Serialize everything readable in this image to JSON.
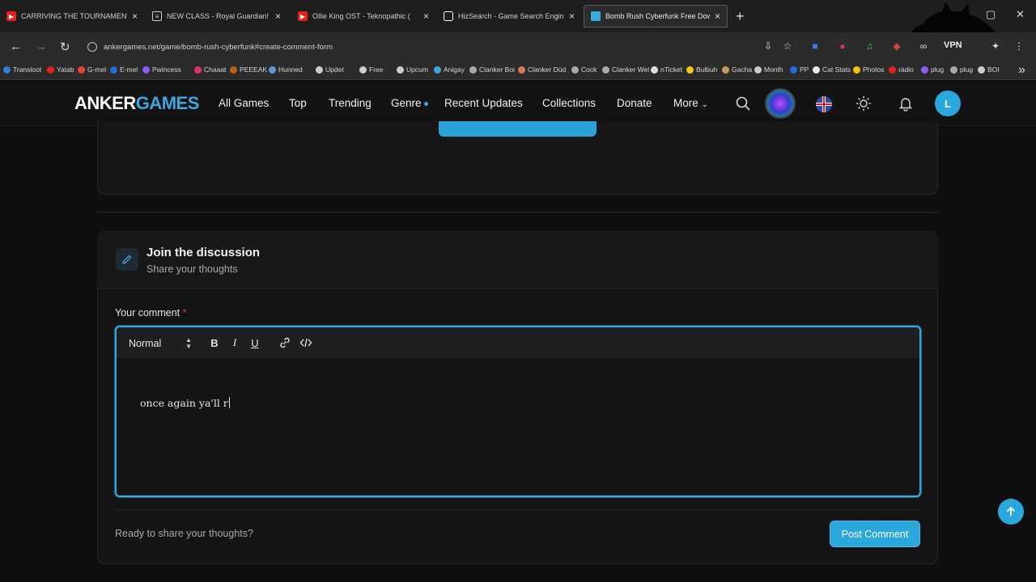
{
  "browser": {
    "tabs": [
      {
        "title": "CARRIVING THE TOURNAMENT WI",
        "icon": "youtube-icon",
        "color": "#e62117"
      },
      {
        "title": "NEW CLASS - Royal Guardian! - Le",
        "icon": "stack-icon",
        "color": "#cccccc"
      },
      {
        "title": "Ollie King OST - Teknopathic (",
        "icon": "youtube-icon",
        "color": "#e62117"
      },
      {
        "title": "HizSearch - Game Search Engine",
        "icon": "search-logo-icon",
        "color": "#ffffff"
      },
      {
        "title": "Bomb Rush Cyberfunk Free Downl",
        "icon": "gamepad-icon",
        "color": "#3aa8e0"
      }
    ],
    "url": "ankergames.net/game/bomb-rush-cyberfunk#create-comment-form",
    "vpn_label": "VPN",
    "bookmarks": [
      "Transloot",
      "Yatab",
      "G-mel",
      "E-mel",
      "Pwincess",
      "Chaaat",
      "PEEEAK",
      "Hunned",
      "Updet",
      "Free",
      "Upcum",
      "Anigay",
      "Clanker Boi",
      "Clanker Düd",
      "Cock",
      "Clanker Wel",
      "nTicket",
      "Bulbuh",
      "Gacha",
      "Month",
      "PP",
      "Cat Stats",
      "Photos",
      "rádio",
      "plug",
      "plug",
      "BOI"
    ]
  },
  "site": {
    "logo_part1": "ANKER",
    "logo_part2": "GAMES",
    "nav": [
      "All Games",
      "Top",
      "Trending",
      "Genre",
      "Recent Updates",
      "Collections",
      "Donate",
      "More"
    ],
    "avatar_initial": "L",
    "accent": "#2aa7dd"
  },
  "discussion": {
    "title": "Join the discussion",
    "subtitle": "Share your thoughts",
    "field_label": "Your comment",
    "required_mark": "*",
    "format_value": "Normal",
    "comment_text": "once again ya'll r",
    "footer_text": "Ready to share your thoughts?",
    "post_button": "Post Comment"
  }
}
